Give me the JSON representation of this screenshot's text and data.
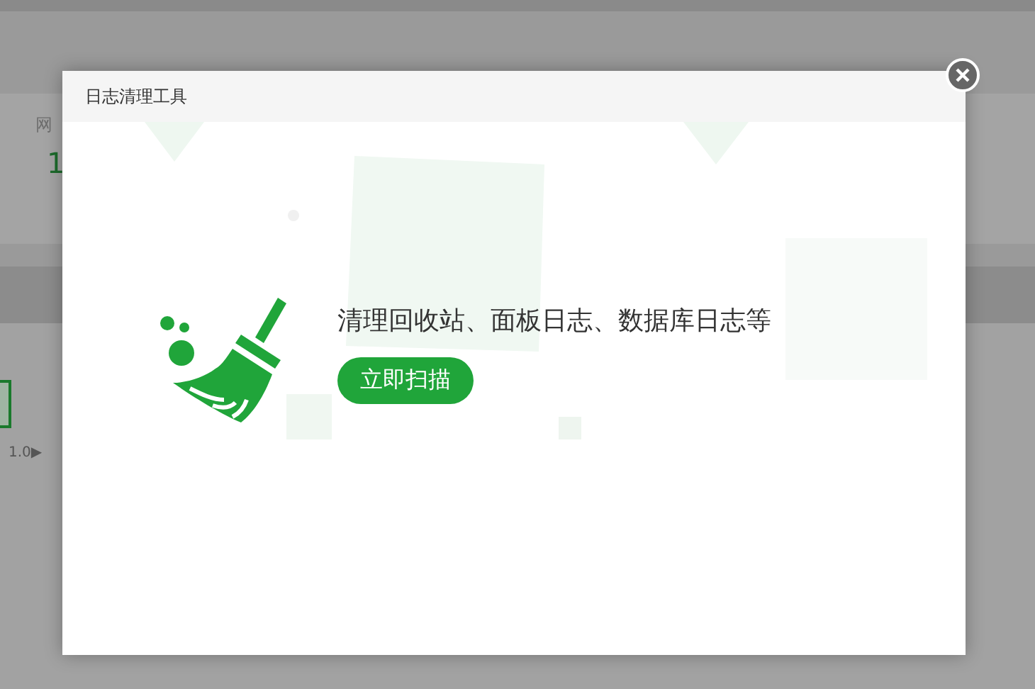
{
  "background": {
    "stat_label": "网",
    "stat_value": "1",
    "version_text": "1.0▶"
  },
  "dialog": {
    "title": "日志清理工具",
    "description": "清理回收站、面板日志、数据库日志等",
    "scan_button": "立即扫描"
  }
}
